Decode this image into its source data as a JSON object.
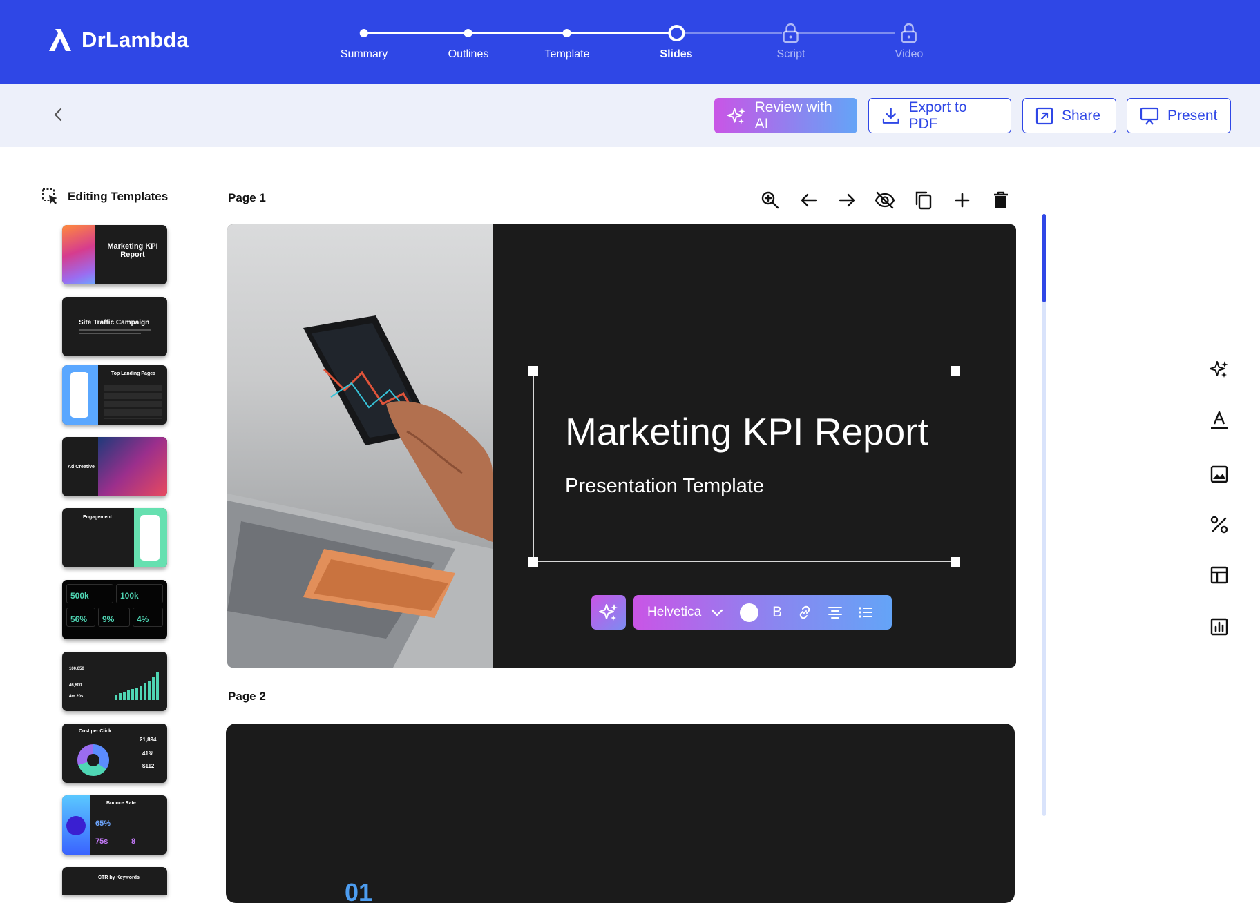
{
  "app": {
    "name": "DrLambda"
  },
  "stepper": {
    "steps": [
      {
        "label": "Summary",
        "state": "done"
      },
      {
        "label": "Outlines",
        "state": "done"
      },
      {
        "label": "Template",
        "state": "done"
      },
      {
        "label": "Slides",
        "state": "current"
      },
      {
        "label": "Script",
        "state": "locked"
      },
      {
        "label": "Video",
        "state": "locked"
      }
    ]
  },
  "toolbar": {
    "back_icon": "chevron-left-icon",
    "review_label": "Review with AI",
    "export_label": "Export to PDF",
    "share_label": "Share",
    "present_label": "Present"
  },
  "sidebar": {
    "title": "Editing Templates",
    "thumbnails": [
      {
        "caption": "Marketing KPI Report"
      },
      {
        "caption": "Site Traffic Campaign"
      },
      {
        "caption": "Top Landing Pages"
      },
      {
        "caption": "Ad Creative"
      },
      {
        "caption": "Engagement"
      },
      {
        "kpis": [
          "500k",
          "100k",
          "56%",
          "9%",
          "4%"
        ]
      },
      {
        "kpis": [
          "100,650",
          "46,600",
          "4m 20s"
        ]
      },
      {
        "caption": "Cost per Click",
        "kpis": [
          "21,894",
          "41%",
          "$112"
        ]
      },
      {
        "caption": "Bounce Rate",
        "kpis": [
          "65%",
          "75s",
          "8"
        ]
      },
      {
        "caption": "CTR by Keywords"
      }
    ]
  },
  "pages": [
    {
      "label": "Page 1",
      "title": "Marketing KPI Report",
      "subtitle": "Presentation Template"
    },
    {
      "label": "Page 2",
      "number": "01"
    }
  ],
  "page_tools": [
    "zoom-in-icon",
    "arrow-left-icon",
    "arrow-right-icon",
    "eye-off-icon",
    "copy-icon",
    "plus-icon",
    "trash-icon"
  ],
  "format_bar": {
    "font": "Helvetica",
    "bold": "B"
  },
  "right_tools": [
    "sparkles-icon",
    "text-color-icon",
    "image-icon",
    "percent-icon",
    "table-icon",
    "chart-icon"
  ],
  "colors": {
    "brand": "#2f47e6",
    "accent_gradient_start": "#c955e6",
    "accent_gradient_end": "#64a4f7",
    "slide_bg": "#1b1b1b"
  }
}
